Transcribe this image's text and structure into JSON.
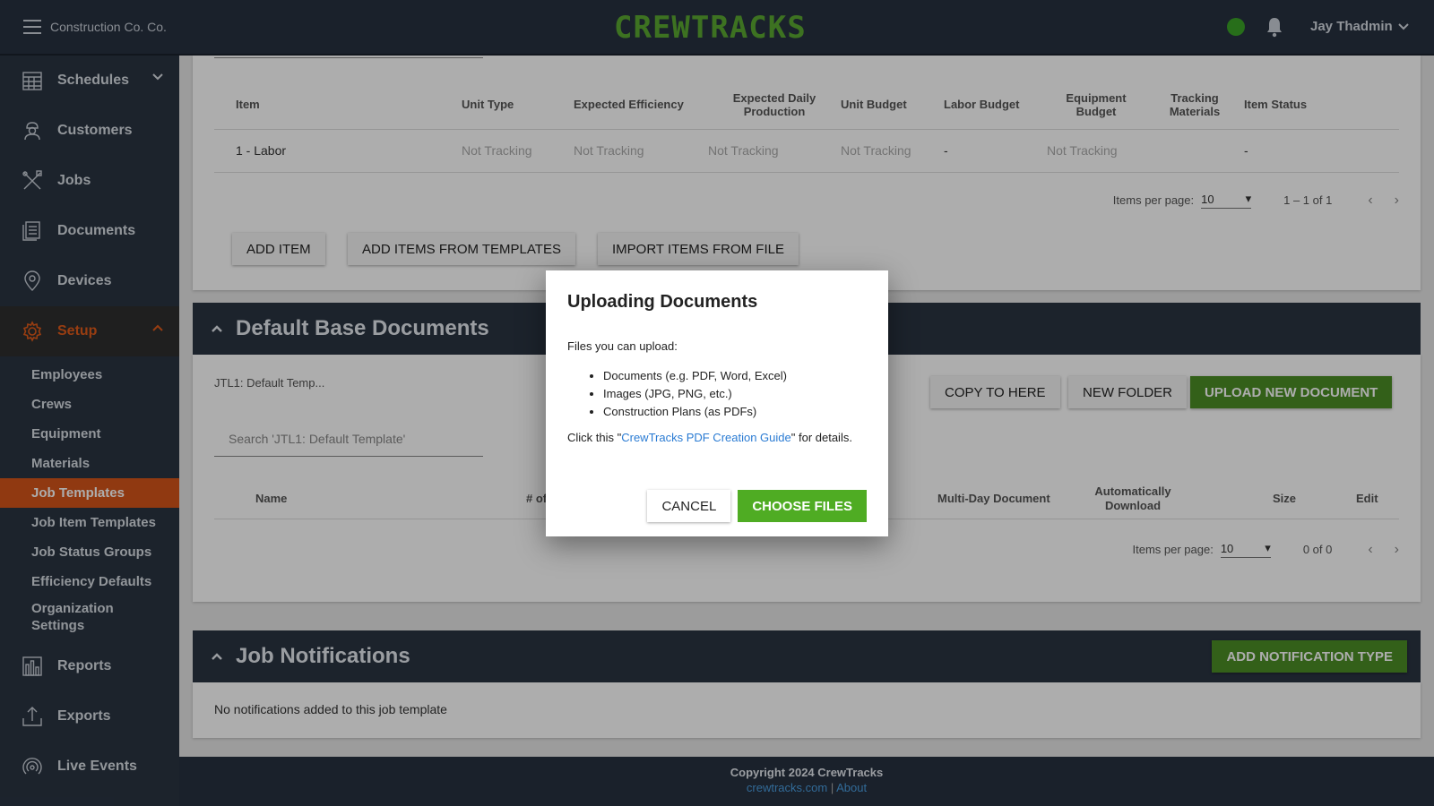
{
  "header": {
    "org_name": "Construction Co. Co.",
    "logo_text": "CREWTRACKS",
    "user_name": "Jay Thadmin",
    "status_color": "#3aa227"
  },
  "sidebar": {
    "items_top": [
      {
        "label": "Schedules",
        "icon": "calendar-icon",
        "expandable": true
      },
      {
        "label": "Customers",
        "icon": "worker-icon"
      },
      {
        "label": "Jobs",
        "icon": "tools-icon"
      },
      {
        "label": "Documents",
        "icon": "documents-icon"
      },
      {
        "label": "Devices",
        "icon": "location-pin-icon"
      }
    ],
    "setup": {
      "label": "Setup",
      "icon": "gear-icon",
      "expanded": true
    },
    "setup_items": [
      {
        "label": "Employees"
      },
      {
        "label": "Crews"
      },
      {
        "label": "Equipment"
      },
      {
        "label": "Materials"
      },
      {
        "label": "Job Templates",
        "active": true
      },
      {
        "label": "Job Item Templates"
      },
      {
        "label": "Job Status Groups"
      },
      {
        "label": "Efficiency Defaults"
      },
      {
        "label": "Organization Settings"
      }
    ],
    "items_bottom": [
      {
        "label": "Reports",
        "icon": "bar-chart-icon"
      },
      {
        "label": "Exports",
        "icon": "upload-icon"
      },
      {
        "label": "Live Events",
        "icon": "broadcast-icon"
      }
    ]
  },
  "items_table": {
    "columns": [
      "Item",
      "Unit Type",
      "Expected Efficiency",
      "Expected Daily Production",
      "Unit Budget",
      "Labor Budget",
      "Equipment Budget",
      "Tracking Materials",
      "Item Status"
    ],
    "rows": [
      [
        "1 - Labor",
        "Not Tracking",
        "Not Tracking",
        "Not Tracking",
        "Not Tracking",
        "-",
        "Not Tracking",
        "",
        "-"
      ]
    ],
    "pager": {
      "label": "Items per page:",
      "per_page": "10",
      "range": "1 – 1 of 1"
    },
    "buttons": {
      "add_item": "ADD ITEM",
      "add_from_templates": "ADD ITEMS FROM TEMPLATES",
      "import_from_file": "IMPORT ITEMS FROM FILE"
    }
  },
  "documents": {
    "title": "Default Base Documents",
    "path": "JTL1: Default Temp...",
    "search_placeholder": "Search 'JTL1: Default Template'",
    "buttons": {
      "copy_to_here": "COPY TO HERE",
      "new_folder": "NEW FOLDER",
      "upload_new": "UPLOAD NEW DOCUMENT"
    },
    "columns": {
      "name": "Name",
      "count": "# of",
      "multi_day": "Multi-Day Document",
      "auto_download": "Automatically Download",
      "size": "Size",
      "edit": "Edit"
    },
    "pager": {
      "label": "Items per page:",
      "per_page": "10",
      "range": "0 of 0"
    }
  },
  "notifications": {
    "title": "Job Notifications",
    "add_button": "ADD NOTIFICATION TYPE",
    "empty_text": "No notifications added to this job template"
  },
  "footer": {
    "copyright": "Copyright 2024 CrewTracks",
    "link_site": "crewtracks.com",
    "separator": "|",
    "link_about": "About"
  },
  "dialog": {
    "title": "Uploading Documents",
    "intro": "Files you can upload:",
    "file_types": [
      "Documents (e.g. PDF, Word, Excel)",
      "Images (JPG, PNG, etc.)",
      "Construction Plans (as PDFs)"
    ],
    "guide_prefix": "Click this \"",
    "guide_link": "CrewTracks PDF Creation Guide",
    "guide_suffix": "\" for details.",
    "cancel": "CANCEL",
    "choose_files": "CHOOSE FILES"
  }
}
